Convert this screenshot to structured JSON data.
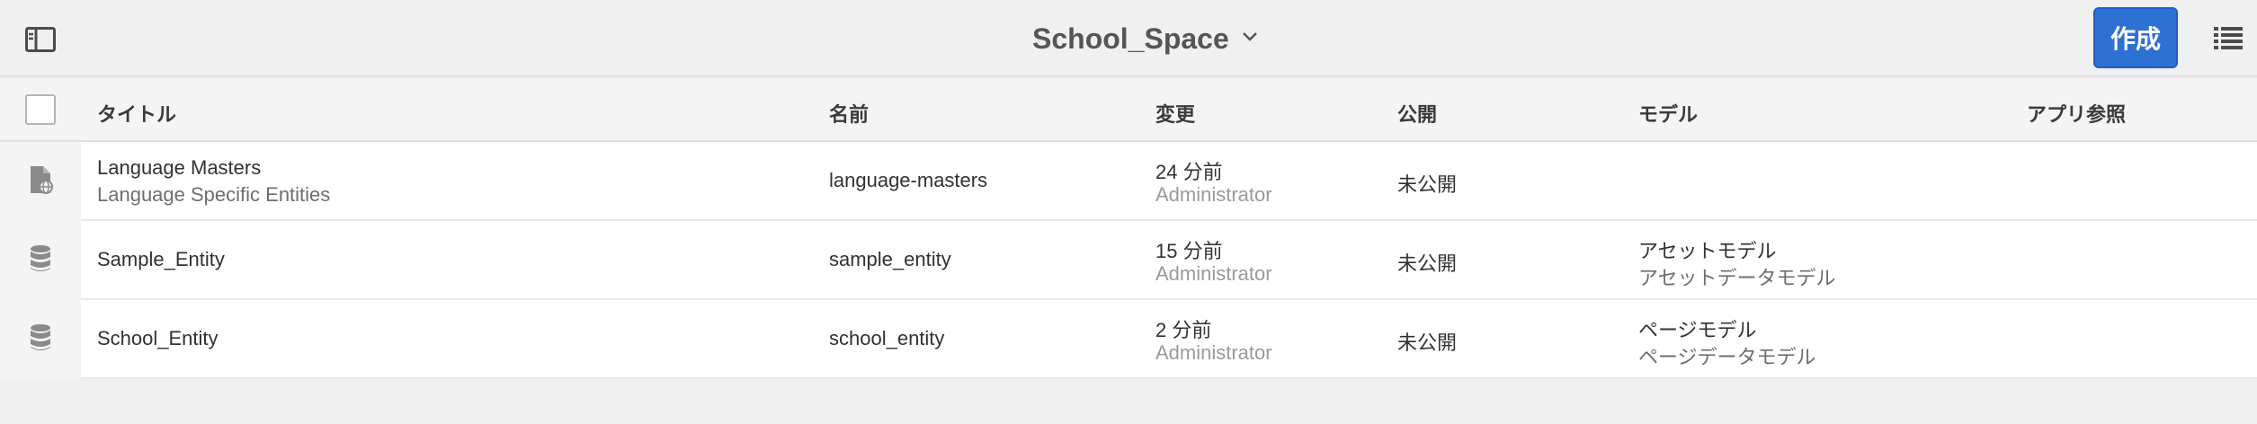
{
  "header": {
    "title": "School_Space",
    "create_label": "作成"
  },
  "table": {
    "columns": [
      "タイトル",
      "名前",
      "変更",
      "公開",
      "モデル",
      "アプリ参照"
    ],
    "rows": [
      {
        "icon": "file-globe-icon",
        "title": "Language Masters",
        "description": "Language Specific Entities",
        "name": "language-masters",
        "modified": "24 分前",
        "modified_by": "Administrator",
        "published": "未公開",
        "model": "",
        "model_sub": "",
        "app_ref": ""
      },
      {
        "icon": "database-icon",
        "title": "Sample_Entity",
        "description": "",
        "name": "sample_entity",
        "modified": "15 分前",
        "modified_by": "Administrator",
        "published": "未公開",
        "model": "アセットモデル",
        "model_sub": "アセットデータモデル",
        "app_ref": ""
      },
      {
        "icon": "database-icon",
        "title": "School_Entity",
        "description": "",
        "name": "school_entity",
        "modified": "2 分前",
        "modified_by": "Administrator",
        "published": "未公開",
        "model": "ページモデル",
        "model_sub": "ページデータモデル",
        "app_ref": ""
      }
    ]
  },
  "colors": {
    "accent": "#2d72d2",
    "background": "#f0f0f0",
    "row_background": "#ffffff"
  }
}
